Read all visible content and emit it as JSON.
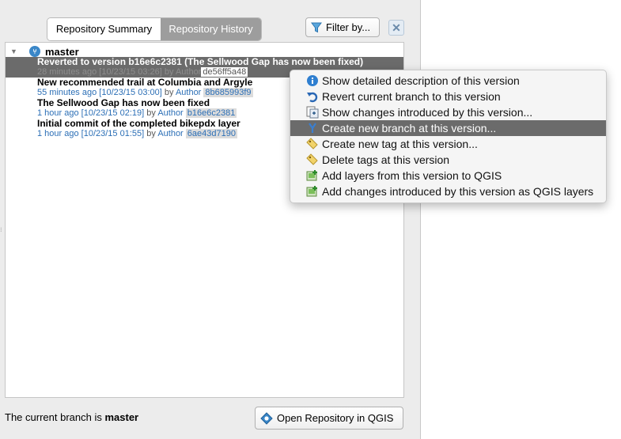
{
  "tabs": [
    {
      "label": "Repository Summary",
      "active": true
    },
    {
      "label": "Repository History",
      "active": false
    }
  ],
  "filter_button": {
    "label": "Filter by..."
  },
  "clear_button": {
    "label": "✕"
  },
  "branch": {
    "name": "master"
  },
  "commits": [
    {
      "message": "Reverted to version b16e6c2381 (The Sellwood Gap has now been fixed)",
      "time": "28 minutes ago [10/23/15 03:26]",
      "by": "by",
      "author": "Author",
      "hash": "de56ff5a48",
      "selected": true
    },
    {
      "message": "New recommended trail at Columbia and Argyle",
      "time": "55 minutes ago [10/23/15 03:00]",
      "by": "by",
      "author": "Author",
      "hash": "8b685993f9",
      "selected": false
    },
    {
      "message": "The Sellwood Gap has now been fixed",
      "time": "1 hour ago [10/23/15 02:19]",
      "by": "by",
      "author": "Author",
      "hash": "b16e6c2381",
      "selected": false
    },
    {
      "message": "Initial commit of the completed bikepdx layer",
      "time": "1 hour ago [10/23/15 01:55]",
      "by": "by",
      "author": "Author",
      "hash": "6ae43d7190",
      "selected": false
    }
  ],
  "status": {
    "prefix": "The current branch is",
    "branch": "master"
  },
  "open_button": {
    "label": "Open Repository in QGIS"
  },
  "context_menu": [
    {
      "label": "Show detailed description of this version",
      "icon": "info-icon"
    },
    {
      "label": "Revert current branch to this version",
      "icon": "revert-icon"
    },
    {
      "label": "Show changes introduced by this version...",
      "icon": "diff-icon"
    },
    {
      "label": "Create new branch at this version...",
      "icon": "branch-icon",
      "highlighted": true
    },
    {
      "label": "Create new tag at this version...",
      "icon": "tag-icon"
    },
    {
      "label": "Delete tags at this version",
      "icon": "tag-delete-icon"
    },
    {
      "label": "Add layers from this version to QGIS",
      "icon": "add-layer-icon"
    },
    {
      "label": "Add changes introduced by this version as QGIS layers",
      "icon": "add-layer-icon"
    }
  ],
  "colors": {
    "accent_blue": "#2c6fb6",
    "selection": "#6b6b6b",
    "tab_inactive": "#9d9d9d"
  }
}
